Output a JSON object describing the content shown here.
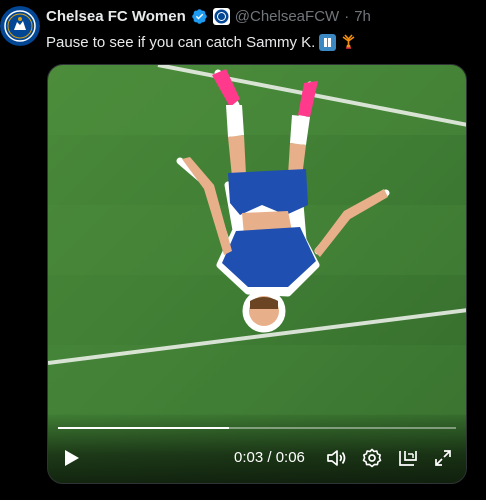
{
  "account": {
    "display_name": "Chelsea FC Women",
    "handle": "@ChelseaFCW",
    "separator": "·",
    "time": "7h"
  },
  "tweet": {
    "text": "Pause to see if you can catch Sammy K."
  },
  "video": {
    "timecode": "0:03 / 0:06",
    "progress": 0.43
  },
  "colors": {
    "verified": "#1d9bf0",
    "chelsea_blue": "#034694",
    "pitch": "#3f7d34"
  },
  "icons": [
    "chelsea-crest-icon",
    "verified-badge-icon",
    "affiliate-badge-icon",
    "pause-button-emoji",
    "cartwheel-emoji",
    "play-icon",
    "volume-icon",
    "settings-gear-icon",
    "pip-icon",
    "fullscreen-icon"
  ]
}
